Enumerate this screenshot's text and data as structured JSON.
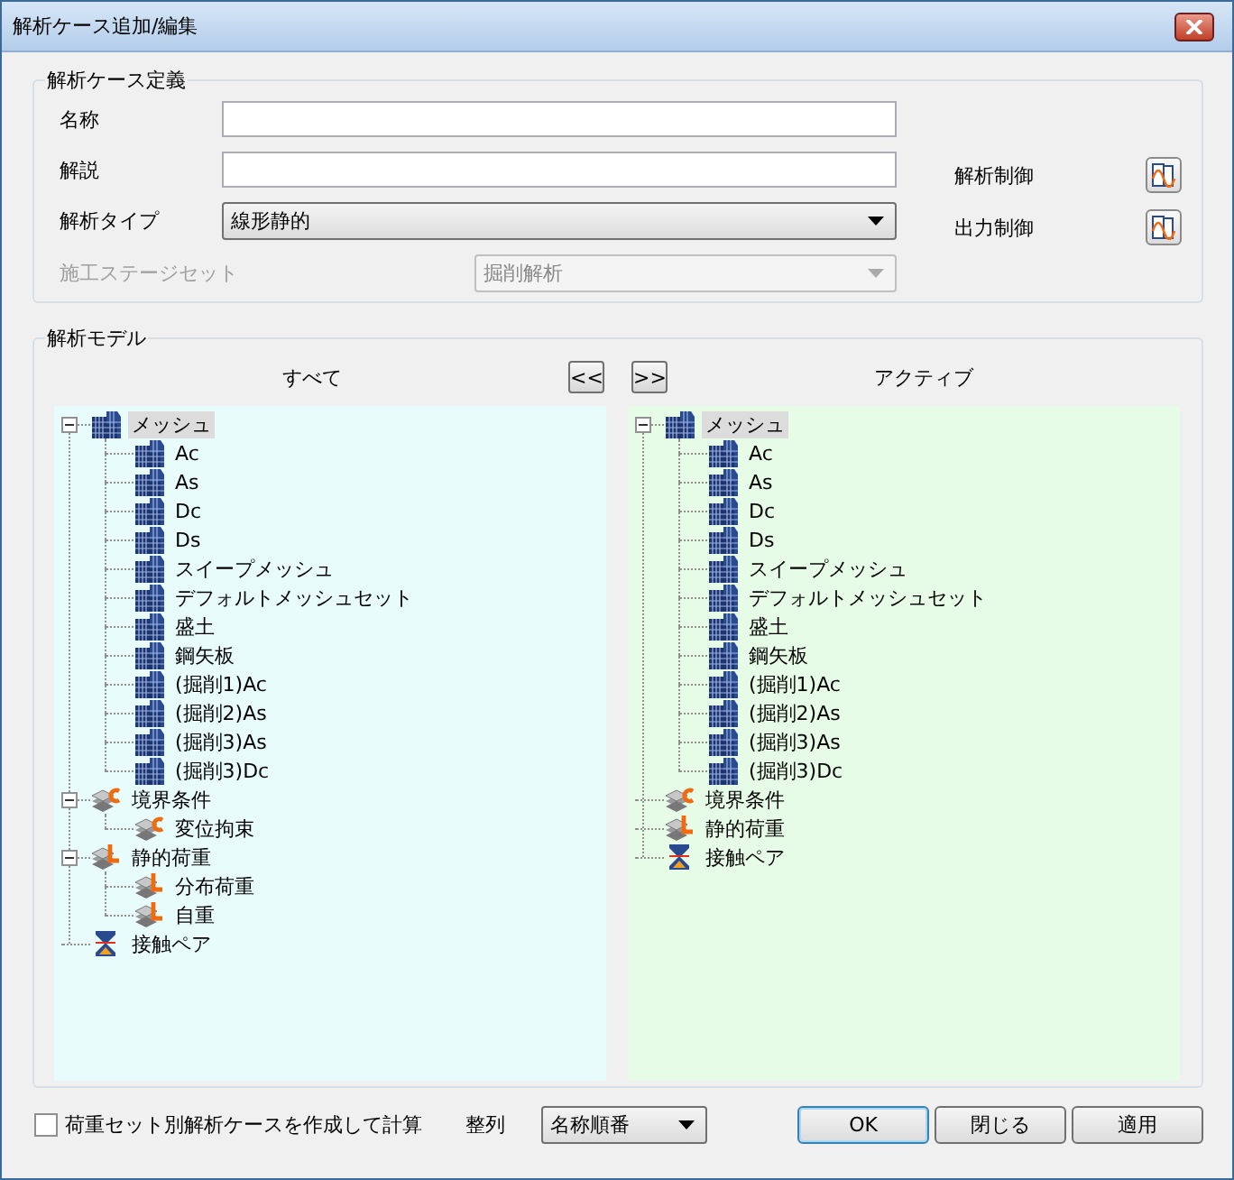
{
  "window": {
    "title": "解析ケース追加/編集"
  },
  "case_definition": {
    "title": "解析ケース定義",
    "fields": [
      {
        "label": "名称",
        "kind": "text"
      },
      {
        "label": "解説",
        "kind": "text"
      },
      {
        "label": "解析タイプ",
        "kind": "select",
        "value": "線形静的",
        "disabled": false
      },
      {
        "label": "施工ステージセット",
        "kind": "select",
        "value": "掘削解析",
        "disabled": true
      }
    ],
    "controls": [
      {
        "label": "解析制御"
      },
      {
        "label": "出力制御"
      }
    ]
  },
  "model": {
    "title": "解析モデル",
    "move_left": "<<",
    "move_right": ">>",
    "all": {
      "heading": "すべて",
      "tree": [
        {
          "label": "メッシュ",
          "kind": "mesh",
          "expanded": true,
          "selected": true,
          "children": [
            {
              "label": "Ac",
              "kind": "mesh",
              "selected": false
            },
            {
              "label": "As",
              "kind": "mesh",
              "selected": false
            },
            {
              "label": "Dc",
              "kind": "mesh",
              "selected": false
            },
            {
              "label": "Ds",
              "kind": "mesh",
              "selected": false
            },
            {
              "label": "スイープメッシュ",
              "kind": "mesh",
              "selected": false
            },
            {
              "label": "デフォルトメッシュセット",
              "kind": "mesh",
              "selected": false
            },
            {
              "label": "盛土",
              "kind": "mesh",
              "selected": false
            },
            {
              "label": "鋼矢板",
              "kind": "mesh",
              "selected": false
            },
            {
              "label": "(掘削1)Ac",
              "kind": "mesh",
              "selected": false
            },
            {
              "label": "(掘削2)As",
              "kind": "mesh",
              "selected": false
            },
            {
              "label": "(掘削3)As",
              "kind": "mesh",
              "selected": false
            },
            {
              "label": "(掘削3)Dc",
              "kind": "mesh",
              "selected": false
            }
          ]
        },
        {
          "label": "境界条件",
          "kind": "boundary",
          "expanded": true,
          "selected": false,
          "children": [
            {
              "label": "変位拘束",
              "kind": "boundary",
              "selected": false
            }
          ]
        },
        {
          "label": "静的荷重",
          "kind": "load",
          "expanded": true,
          "selected": false,
          "children": [
            {
              "label": "分布荷重",
              "kind": "load",
              "selected": false
            },
            {
              "label": "自重",
              "kind": "load",
              "selected": false
            }
          ]
        },
        {
          "label": "接触ペア",
          "kind": "contact",
          "selected": false
        }
      ]
    },
    "active": {
      "heading": "アクティブ",
      "tree": [
        {
          "label": "メッシュ",
          "kind": "mesh",
          "expanded": true,
          "selected": true,
          "children": [
            {
              "label": "Ac",
              "kind": "mesh",
              "selected": false
            },
            {
              "label": "As",
              "kind": "mesh",
              "selected": false
            },
            {
              "label": "Dc",
              "kind": "mesh",
              "selected": false
            },
            {
              "label": "Ds",
              "kind": "mesh",
              "selected": false
            },
            {
              "label": "スイープメッシュ",
              "kind": "mesh",
              "selected": false
            },
            {
              "label": "デフォルトメッシュセット",
              "kind": "mesh",
              "selected": false
            },
            {
              "label": "盛土",
              "kind": "mesh",
              "selected": false
            },
            {
              "label": "鋼矢板",
              "kind": "mesh",
              "selected": false
            },
            {
              "label": "(掘削1)Ac",
              "kind": "mesh",
              "selected": false
            },
            {
              "label": "(掘削2)As",
              "kind": "mesh",
              "selected": false
            },
            {
              "label": "(掘削3)As",
              "kind": "mesh",
              "selected": false
            },
            {
              "label": "(掘削3)Dc",
              "kind": "mesh",
              "selected": false
            }
          ]
        },
        {
          "label": "境界条件",
          "kind": "boundary",
          "selected": false
        },
        {
          "label": "静的荷重",
          "kind": "load",
          "selected": false
        },
        {
          "label": "接触ペア",
          "kind": "contact",
          "selected": false
        }
      ]
    }
  },
  "footer": {
    "checkbox": {
      "label": "荷重セット別解析ケースを作成して計算",
      "checked": false
    },
    "sort": {
      "label": "整列",
      "value": "名称順番"
    },
    "buttons": [
      {
        "label": "OK",
        "default": true
      },
      {
        "label": "閉じる",
        "default": false
      },
      {
        "label": "適用",
        "default": false
      }
    ]
  }
}
